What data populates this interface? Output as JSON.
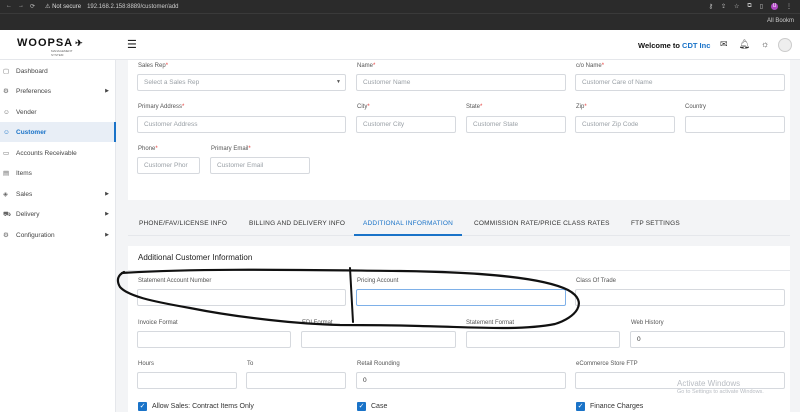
{
  "browser": {
    "nav_back": "←",
    "nav_forward": "→",
    "nav_reload": "⟳",
    "security": "⚠ Not secure",
    "url": "192.168.2.158:8889/customer/add",
    "profile": "U",
    "all_bookmarks": "All Bookm"
  },
  "header": {
    "logo_text": "WOOPSA",
    "logo_tagline": "MANAGEMENT SYSTEM",
    "welcome_prefix": "Welcome to ",
    "company": "CDT Inc"
  },
  "sidebar": {
    "items": [
      {
        "label": "Dashboard",
        "icon": "▢",
        "caret": ""
      },
      {
        "label": "Preferences",
        "icon": "⚙",
        "caret": "▶"
      },
      {
        "label": "Vender",
        "icon": "☺",
        "caret": ""
      },
      {
        "label": "Customer",
        "icon": "☺",
        "caret": ""
      },
      {
        "label": "Accounts Receivable",
        "icon": "▭",
        "caret": ""
      },
      {
        "label": "Items",
        "icon": "▤",
        "caret": ""
      },
      {
        "label": "Sales",
        "icon": "◈",
        "caret": "▶"
      },
      {
        "label": "Delivery",
        "icon": "⛟",
        "caret": "▶"
      },
      {
        "label": "Configuration",
        "icon": "⚙",
        "caret": "▶"
      }
    ]
  },
  "form": {
    "sales_rep": {
      "label": "Sales Rep",
      "placeholder": "Select a Sales Rep"
    },
    "name": {
      "label": "Name",
      "placeholder": "Customer Name"
    },
    "co_name": {
      "label": "c/o Name",
      "placeholder": "Customer Care of Name"
    },
    "primary_address": {
      "label": "Primary Address",
      "placeholder": "Customer Address"
    },
    "city": {
      "label": "City",
      "placeholder": "Customer City"
    },
    "state": {
      "label": "State",
      "placeholder": "Customer State"
    },
    "zip": {
      "label": "Zip",
      "placeholder": "Customer Zip Code"
    },
    "country": {
      "label": "Country",
      "placeholder": ""
    },
    "phone": {
      "label": "Phone",
      "placeholder": "Customer Phor"
    },
    "primary_email": {
      "label": "Primary Email",
      "placeholder": "Customer Email"
    },
    "required_mark": "*"
  },
  "tabs": [
    {
      "label": "PHONE/FAV/LICENSE INFO",
      "active": false
    },
    {
      "label": "BILLING AND DELIVERY INFO",
      "active": false
    },
    {
      "label": "ADDITIONAL INFORMATION",
      "active": true
    },
    {
      "label": "COMMISSION RATE/PRICE CLASS RATES",
      "active": false
    },
    {
      "label": "FTP SETTINGS",
      "active": false
    }
  ],
  "additional": {
    "title": "Additional Customer Information",
    "statement_account_number": {
      "label": "Statement Account Number",
      "value": ""
    },
    "pricing_account": {
      "label": "Pricing Account",
      "value": ""
    },
    "class_of_trade": {
      "label": "Class Of Trade",
      "value": ""
    },
    "invoice_format": {
      "label": "Invoice Format",
      "value": ""
    },
    "edi_format": {
      "label": "EDI Format",
      "value": ""
    },
    "statement_format": {
      "label": "Statement Format",
      "value": ""
    },
    "web_history": {
      "label": "Web History",
      "value": "0"
    },
    "hours": {
      "label": "Hours",
      "value": ""
    },
    "to": {
      "label": "To",
      "value": ""
    },
    "retail_rounding": {
      "label": "Retail Rounding",
      "value": "0"
    },
    "ecommerce_store_ftp": {
      "label": "eCommerce Store FTP",
      "value": ""
    },
    "allow_sales": {
      "label": "Allow Sales: Contract Items Only",
      "checked": true
    },
    "case": {
      "label": "Case",
      "checked": true
    },
    "finance_charges": {
      "label": "Finance Charges",
      "checked": true
    }
  },
  "watermark": {
    "line1": "Activate Windows",
    "line2": "Go to Settings to activate Windows."
  },
  "colors": {
    "accent": "#1a73c8",
    "required": "#e53935"
  }
}
